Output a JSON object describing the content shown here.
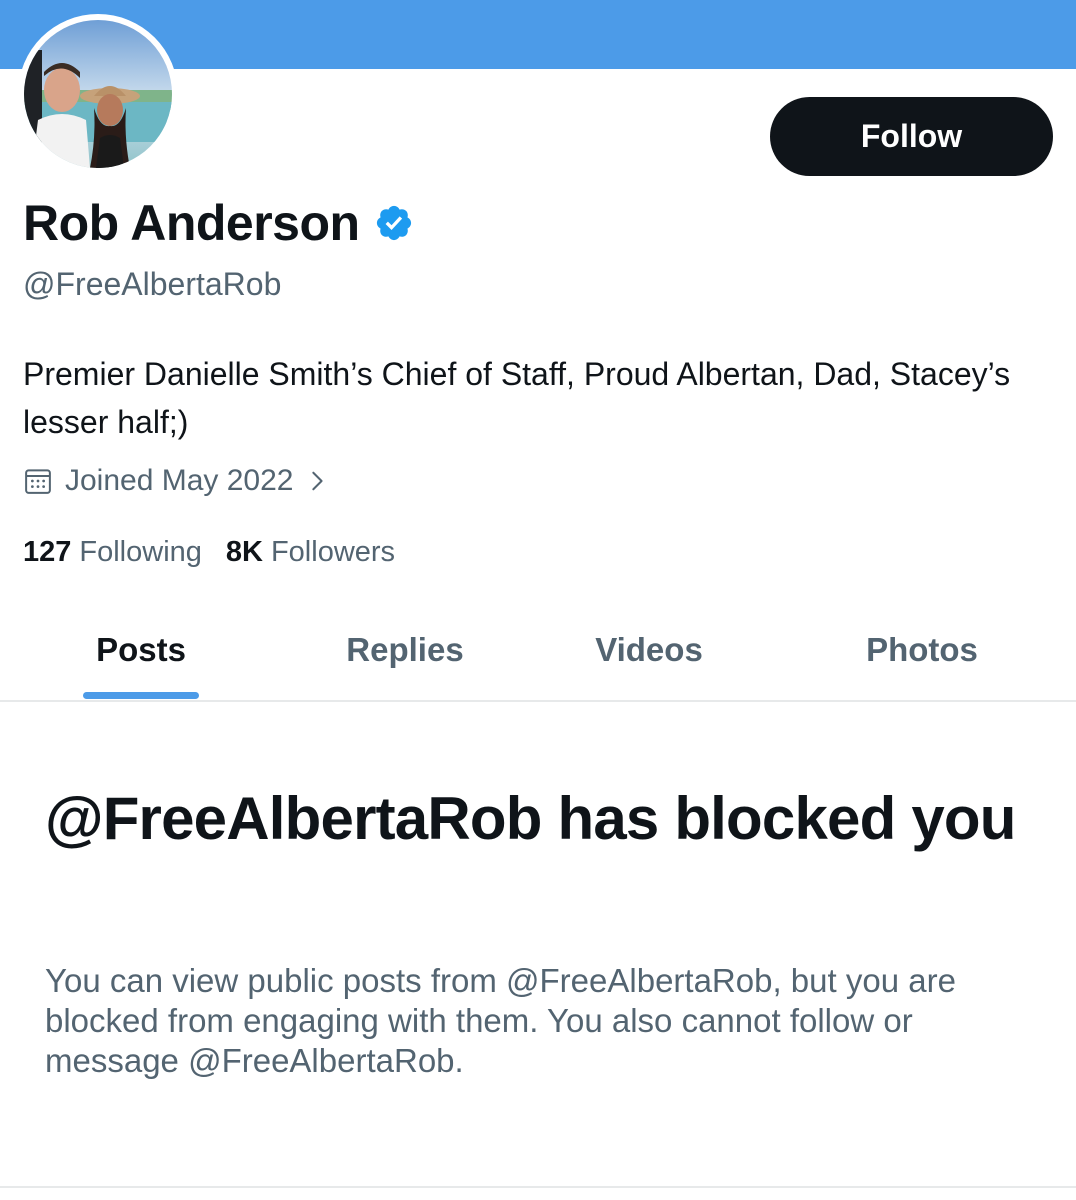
{
  "profile": {
    "name": "Rob Anderson",
    "handle": "@FreeAlbertaRob",
    "bio": "Premier Danielle Smith’s Chief of Staff, Proud Albertan, Dad, Stacey’s lesser half;)",
    "joined": "Joined May 2022",
    "following_count": "127",
    "following_label": "Following",
    "followers_count": "8K",
    "followers_label": "Followers",
    "verified": true
  },
  "actions": {
    "follow_label": "Follow"
  },
  "tabs": [
    {
      "label": "Posts",
      "active": true
    },
    {
      "label": "Replies",
      "active": false
    },
    {
      "label": "Videos",
      "active": false
    },
    {
      "label": "Photos",
      "active": false
    }
  ],
  "blocked": {
    "title": "@FreeAlbertaRob has blocked you",
    "message": "You can view public posts from @FreeAlbertaRob, but you are blocked from engaging with them. You also cannot follow or message @FreeAlbertaRob."
  },
  "colors": {
    "banner": "#4c9be8",
    "verified_badge": "#1d9bf0",
    "primary_text": "#0f1419",
    "secondary_text": "#536471",
    "follow_button": "#0f1419",
    "tab_indicator": "#4c9be8"
  },
  "icons": {
    "verified": "verified-badge-icon",
    "joined": "calendar-icon",
    "joined_more": "chevron-right-icon"
  }
}
